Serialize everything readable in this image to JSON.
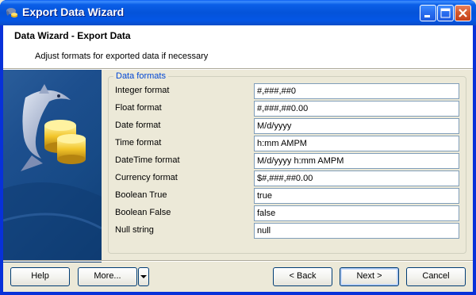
{
  "window": {
    "title": "Export Data Wizard",
    "accent_color": "#0453d9",
    "icon": "dolphin-app-icon"
  },
  "title_buttons": {
    "minimize_icon": "minimize-icon",
    "maximize_icon": "maximize-icon",
    "close_icon": "close-icon"
  },
  "header": {
    "title": "Data Wizard - Export Data",
    "subtitle": "Adjust formats for exported data if necessary"
  },
  "side_panel": {
    "image": "dolphin-database-icon",
    "background_color": "#1d4f8e"
  },
  "formats": {
    "legend": "Data formats",
    "legend_color": "#0046d5",
    "rows": [
      {
        "label": "Integer format",
        "value": "#,###,##0"
      },
      {
        "label": "Float format",
        "value": "#,###,##0.00"
      },
      {
        "label": "Date format",
        "value": "M/d/yyyy"
      },
      {
        "label": "Time format",
        "value": "h:mm AMPM"
      },
      {
        "label": "DateTime format",
        "value": "M/d/yyyy h:mm AMPM"
      },
      {
        "label": "Currency format",
        "value": "$#,###,##0.00"
      },
      {
        "label": "Boolean True",
        "value": "true"
      },
      {
        "label": "Boolean False",
        "value": "false"
      },
      {
        "label": "Null string",
        "value": "null"
      }
    ]
  },
  "buttons": {
    "help": "Help",
    "more": "More...",
    "more_dropdown_icon": "chevron-down-icon",
    "back": "< Back",
    "next": "Next >",
    "cancel": "Cancel"
  }
}
